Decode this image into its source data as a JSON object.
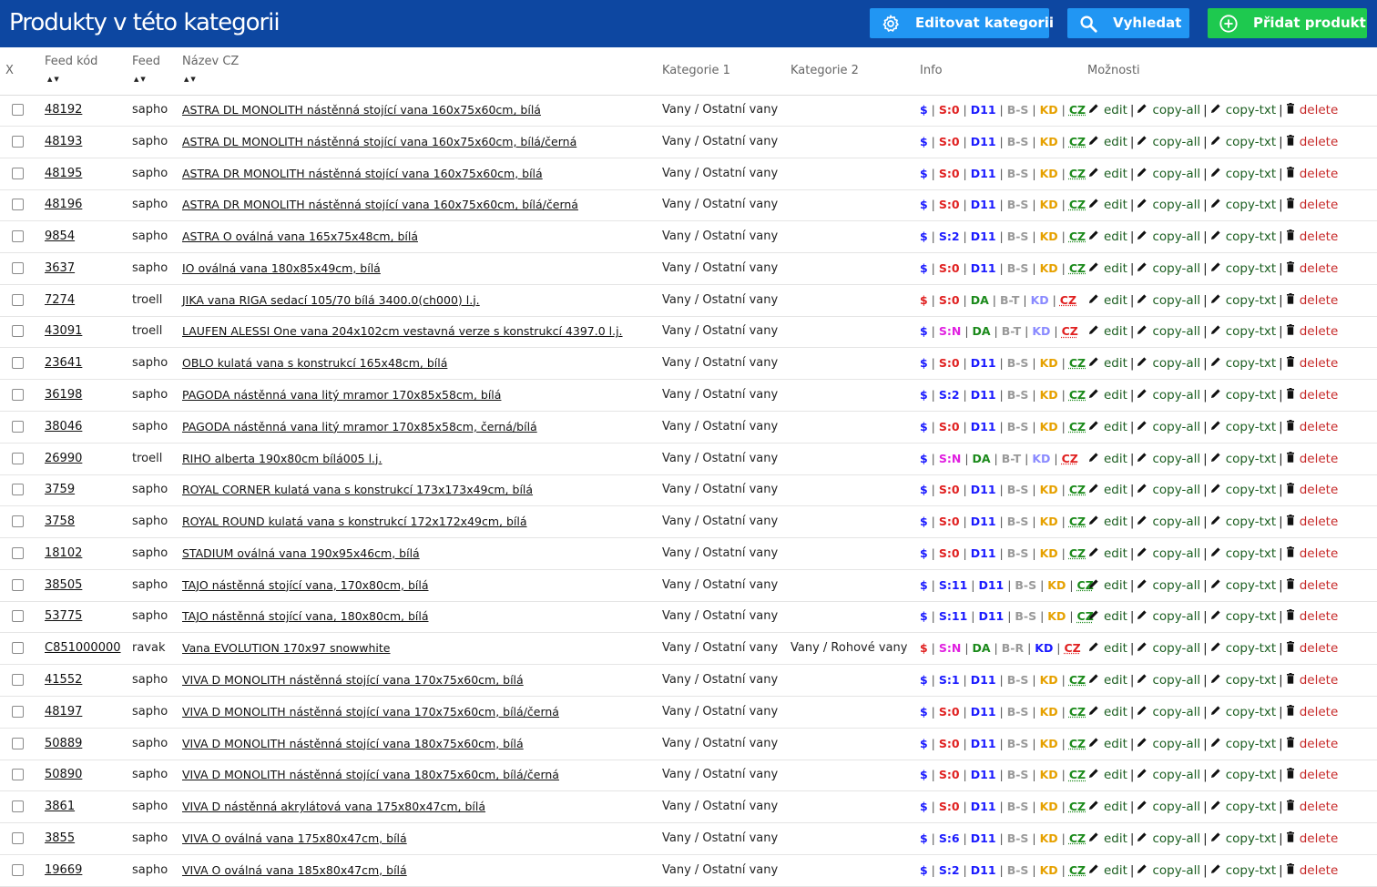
{
  "header": {
    "title": "Produkty v této kategorii",
    "buttons": {
      "edit_category": "Editovat kategorii",
      "search": "Vyhledat",
      "add_product": "Přidat produkt"
    },
    "colors": {
      "bar": "#0d47a1",
      "blue_button": "#2196f3",
      "green_button": "#1ec94f"
    }
  },
  "table": {
    "columns": {
      "x": "X",
      "feed_code": "Feed kód",
      "feed": "Feed",
      "name": "Název CZ",
      "category1": "Kategorie 1",
      "category2": "Kategorie 2",
      "info": "Info",
      "options": "Možnosti"
    },
    "sort_arrows": "▲▼",
    "option_labels": {
      "edit": "edit",
      "copy_all": "copy-all",
      "copy_txt": "copy-txt",
      "delete": "delete"
    },
    "rows": [
      {
        "code": "48192",
        "feed": "sapho",
        "name": "ASTRA DL MONOLITH nástěnná stojící vana 160x75x60cm, bílá",
        "cat1": "Vany / Ostatní vany",
        "cat2": "",
        "info": [
          [
            "$",
            "#1a1aff"
          ],
          [
            "S:0",
            "#e02020"
          ],
          [
            "D11",
            "#1a1aff"
          ],
          [
            "B-S",
            "#999999"
          ],
          [
            "KD",
            "#e6a100"
          ],
          [
            "CZ",
            "#1b8a1b"
          ]
        ]
      },
      {
        "code": "48193",
        "feed": "sapho",
        "name": "ASTRA DL MONOLITH nástěnná stojící vana 160x75x60cm, bílá/černá",
        "cat1": "Vany / Ostatní vany",
        "cat2": "",
        "info": [
          [
            "$",
            "#1a1aff"
          ],
          [
            "S:0",
            "#e02020"
          ],
          [
            "D11",
            "#1a1aff"
          ],
          [
            "B-S",
            "#999999"
          ],
          [
            "KD",
            "#e6a100"
          ],
          [
            "CZ",
            "#1b8a1b"
          ]
        ]
      },
      {
        "code": "48195",
        "feed": "sapho",
        "name": "ASTRA DR MONOLITH nástěnná stojící vana 160x75x60cm, bílá",
        "cat1": "Vany / Ostatní vany",
        "cat2": "",
        "info": [
          [
            "$",
            "#1a1aff"
          ],
          [
            "S:0",
            "#e02020"
          ],
          [
            "D11",
            "#1a1aff"
          ],
          [
            "B-S",
            "#999999"
          ],
          [
            "KD",
            "#e6a100"
          ],
          [
            "CZ",
            "#1b8a1b"
          ]
        ]
      },
      {
        "code": "48196",
        "feed": "sapho",
        "name": "ASTRA DR MONOLITH nástěnná stojící vana 160x75x60cm, bílá/černá",
        "cat1": "Vany / Ostatní vany",
        "cat2": "",
        "info": [
          [
            "$",
            "#1a1aff"
          ],
          [
            "S:0",
            "#e02020"
          ],
          [
            "D11",
            "#1a1aff"
          ],
          [
            "B-S",
            "#999999"
          ],
          [
            "KD",
            "#e6a100"
          ],
          [
            "CZ",
            "#1b8a1b"
          ]
        ]
      },
      {
        "code": "9854",
        "feed": "sapho",
        "name": "ASTRA O oválná vana 165x75x48cm, bílá",
        "cat1": "Vany / Ostatní vany",
        "cat2": "",
        "info": [
          [
            "$",
            "#1a1aff"
          ],
          [
            "S:2",
            "#1a1aff"
          ],
          [
            "D11",
            "#1a1aff"
          ],
          [
            "B-S",
            "#999999"
          ],
          [
            "KD",
            "#e6a100"
          ],
          [
            "CZ",
            "#1b8a1b"
          ]
        ]
      },
      {
        "code": "3637",
        "feed": "sapho",
        "name": "IO oválná vana 180x85x49cm, bílá",
        "cat1": "Vany / Ostatní vany",
        "cat2": "",
        "info": [
          [
            "$",
            "#1a1aff"
          ],
          [
            "S:0",
            "#e02020"
          ],
          [
            "D11",
            "#1a1aff"
          ],
          [
            "B-S",
            "#999999"
          ],
          [
            "KD",
            "#e6a100"
          ],
          [
            "CZ",
            "#1b8a1b"
          ]
        ]
      },
      {
        "code": "7274",
        "feed": "troell",
        "name": "JIKA vana RIGA sedací 105/70 bílá 3400.0(ch000) l.j.",
        "cat1": "Vany / Ostatní vany",
        "cat2": "",
        "info": [
          [
            "$",
            "#e02020"
          ],
          [
            "S:0",
            "#e02020"
          ],
          [
            "DA",
            "#1b8a1b"
          ],
          [
            "B-T",
            "#999999"
          ],
          [
            "KD",
            "#8a8aff"
          ],
          [
            "CZ",
            "#e02020"
          ]
        ]
      },
      {
        "code": "43091",
        "feed": "troell",
        "name": "LAUFEN ALESSI One vana 204x102cm vestavná verze s konstrukcí 4397.0 l.j.",
        "cat1": "Vany / Ostatní vany",
        "cat2": "",
        "info": [
          [
            "$",
            "#1a1aff"
          ],
          [
            "S:N",
            "#e020e0"
          ],
          [
            "DA",
            "#1b8a1b"
          ],
          [
            "B-T",
            "#999999"
          ],
          [
            "KD",
            "#8a8aff"
          ],
          [
            "CZ",
            "#e02020"
          ]
        ]
      },
      {
        "code": "23641",
        "feed": "sapho",
        "name": "OBLO kulatá vana s konstrukcí 165x48cm, bílá",
        "cat1": "Vany / Ostatní vany",
        "cat2": "",
        "info": [
          [
            "$",
            "#1a1aff"
          ],
          [
            "S:0",
            "#e02020"
          ],
          [
            "D11",
            "#1a1aff"
          ],
          [
            "B-S",
            "#999999"
          ],
          [
            "KD",
            "#e6a100"
          ],
          [
            "CZ",
            "#1b8a1b"
          ]
        ]
      },
      {
        "code": "36198",
        "feed": "sapho",
        "name": "PAGODA nástěnná vana litý mramor 170x85x58cm, bílá",
        "cat1": "Vany / Ostatní vany",
        "cat2": "",
        "info": [
          [
            "$",
            "#1a1aff"
          ],
          [
            "S:2",
            "#1a1aff"
          ],
          [
            "D11",
            "#1a1aff"
          ],
          [
            "B-S",
            "#999999"
          ],
          [
            "KD",
            "#e6a100"
          ],
          [
            "CZ",
            "#1b8a1b"
          ]
        ]
      },
      {
        "code": "38046",
        "feed": "sapho",
        "name": "PAGODA nástěnná vana litý mramor 170x85x58cm, černá/bílá",
        "cat1": "Vany / Ostatní vany",
        "cat2": "",
        "info": [
          [
            "$",
            "#1a1aff"
          ],
          [
            "S:0",
            "#e02020"
          ],
          [
            "D11",
            "#1a1aff"
          ],
          [
            "B-S",
            "#999999"
          ],
          [
            "KD",
            "#e6a100"
          ],
          [
            "CZ",
            "#1b8a1b"
          ]
        ]
      },
      {
        "code": "26990",
        "feed": "troell",
        "name": "RIHO alberta 190x80cm bílá005 l.j.",
        "cat1": "Vany / Ostatní vany",
        "cat2": "",
        "info": [
          [
            "$",
            "#1a1aff"
          ],
          [
            "S:N",
            "#e020e0"
          ],
          [
            "DA",
            "#1b8a1b"
          ],
          [
            "B-T",
            "#999999"
          ],
          [
            "KD",
            "#8a8aff"
          ],
          [
            "CZ",
            "#e02020"
          ]
        ]
      },
      {
        "code": "3759",
        "feed": "sapho",
        "name": "ROYAL CORNER kulatá vana s konstrukcí 173x173x49cm, bílá",
        "cat1": "Vany / Ostatní vany",
        "cat2": "",
        "info": [
          [
            "$",
            "#1a1aff"
          ],
          [
            "S:0",
            "#e02020"
          ],
          [
            "D11",
            "#1a1aff"
          ],
          [
            "B-S",
            "#999999"
          ],
          [
            "KD",
            "#e6a100"
          ],
          [
            "CZ",
            "#1b8a1b"
          ]
        ]
      },
      {
        "code": "3758",
        "feed": "sapho",
        "name": "ROYAL ROUND kulatá vana s konstrukcí 172x172x49cm, bílá",
        "cat1": "Vany / Ostatní vany",
        "cat2": "",
        "info": [
          [
            "$",
            "#1a1aff"
          ],
          [
            "S:0",
            "#e02020"
          ],
          [
            "D11",
            "#1a1aff"
          ],
          [
            "B-S",
            "#999999"
          ],
          [
            "KD",
            "#e6a100"
          ],
          [
            "CZ",
            "#1b8a1b"
          ]
        ]
      },
      {
        "code": "18102",
        "feed": "sapho",
        "name": "STADIUM oválná vana 190x95x46cm, bílá",
        "cat1": "Vany / Ostatní vany",
        "cat2": "",
        "info": [
          [
            "$",
            "#1a1aff"
          ],
          [
            "S:0",
            "#e02020"
          ],
          [
            "D11",
            "#1a1aff"
          ],
          [
            "B-S",
            "#999999"
          ],
          [
            "KD",
            "#e6a100"
          ],
          [
            "CZ",
            "#1b8a1b"
          ]
        ]
      },
      {
        "code": "38505",
        "feed": "sapho",
        "name": "TAJO nástěnná stojící vana, 170x80cm, bílá",
        "cat1": "Vany / Ostatní vany",
        "cat2": "",
        "info": [
          [
            "$",
            "#1a1aff"
          ],
          [
            "S:11",
            "#1a1aff"
          ],
          [
            "D11",
            "#1a1aff"
          ],
          [
            "B-S",
            "#999999"
          ],
          [
            "KD",
            "#e6a100"
          ],
          [
            "CZ",
            "#1b8a1b"
          ]
        ]
      },
      {
        "code": "53775",
        "feed": "sapho",
        "name": "TAJO nástěnná stojící vana, 180x80cm, bílá",
        "cat1": "Vany / Ostatní vany",
        "cat2": "",
        "info": [
          [
            "$",
            "#1a1aff"
          ],
          [
            "S:11",
            "#1a1aff"
          ],
          [
            "D11",
            "#1a1aff"
          ],
          [
            "B-S",
            "#999999"
          ],
          [
            "KD",
            "#e6a100"
          ],
          [
            "CZ",
            "#1b8a1b"
          ]
        ]
      },
      {
        "code": "C851000000",
        "feed": "ravak",
        "name": "Vana EVOLUTION 170x97 snowwhite",
        "cat1": "Vany / Ostatní vany",
        "cat2": "Vany / Rohové vany",
        "info": [
          [
            "$",
            "#e02020"
          ],
          [
            "S:N",
            "#e020e0"
          ],
          [
            "DA",
            "#1b8a1b"
          ],
          [
            "B-R",
            "#999999"
          ],
          [
            "KD",
            "#1a1aff"
          ],
          [
            "CZ",
            "#e02020"
          ]
        ]
      },
      {
        "code": "41552",
        "feed": "sapho",
        "name": "VIVA D MONOLITH nástěnná stojící vana 170x75x60cm, bílá",
        "cat1": "Vany / Ostatní vany",
        "cat2": "",
        "info": [
          [
            "$",
            "#1a1aff"
          ],
          [
            "S:1",
            "#1a1aff"
          ],
          [
            "D11",
            "#1a1aff"
          ],
          [
            "B-S",
            "#999999"
          ],
          [
            "KD",
            "#e6a100"
          ],
          [
            "CZ",
            "#1b8a1b"
          ]
        ]
      },
      {
        "code": "48197",
        "feed": "sapho",
        "name": "VIVA D MONOLITH nástěnná stojící vana 170x75x60cm, bílá/černá",
        "cat1": "Vany / Ostatní vany",
        "cat2": "",
        "info": [
          [
            "$",
            "#1a1aff"
          ],
          [
            "S:0",
            "#e02020"
          ],
          [
            "D11",
            "#1a1aff"
          ],
          [
            "B-S",
            "#999999"
          ],
          [
            "KD",
            "#e6a100"
          ],
          [
            "CZ",
            "#1b8a1b"
          ]
        ]
      },
      {
        "code": "50889",
        "feed": "sapho",
        "name": "VIVA D MONOLITH nástěnná stojící vana 180x75x60cm, bílá",
        "cat1": "Vany / Ostatní vany",
        "cat2": "",
        "info": [
          [
            "$",
            "#1a1aff"
          ],
          [
            "S:0",
            "#e02020"
          ],
          [
            "D11",
            "#1a1aff"
          ],
          [
            "B-S",
            "#999999"
          ],
          [
            "KD",
            "#e6a100"
          ],
          [
            "CZ",
            "#1b8a1b"
          ]
        ]
      },
      {
        "code": "50890",
        "feed": "sapho",
        "name": "VIVA D MONOLITH nástěnná stojící vana 180x75x60cm, bílá/černá",
        "cat1": "Vany / Ostatní vany",
        "cat2": "",
        "info": [
          [
            "$",
            "#1a1aff"
          ],
          [
            "S:0",
            "#e02020"
          ],
          [
            "D11",
            "#1a1aff"
          ],
          [
            "B-S",
            "#999999"
          ],
          [
            "KD",
            "#e6a100"
          ],
          [
            "CZ",
            "#1b8a1b"
          ]
        ]
      },
      {
        "code": "3861",
        "feed": "sapho",
        "name": "VIVA D nástěnná akrylátová vana 175x80x47cm, bílá",
        "cat1": "Vany / Ostatní vany",
        "cat2": "",
        "info": [
          [
            "$",
            "#1a1aff"
          ],
          [
            "S:0",
            "#e02020"
          ],
          [
            "D11",
            "#1a1aff"
          ],
          [
            "B-S",
            "#999999"
          ],
          [
            "KD",
            "#e6a100"
          ],
          [
            "CZ",
            "#1b8a1b"
          ]
        ]
      },
      {
        "code": "3855",
        "feed": "sapho",
        "name": "VIVA O oválná vana 175x80x47cm, bílá",
        "cat1": "Vany / Ostatní vany",
        "cat2": "",
        "info": [
          [
            "$",
            "#1a1aff"
          ],
          [
            "S:6",
            "#1a1aff"
          ],
          [
            "D11",
            "#1a1aff"
          ],
          [
            "B-S",
            "#999999"
          ],
          [
            "KD",
            "#e6a100"
          ],
          [
            "CZ",
            "#1b8a1b"
          ]
        ]
      },
      {
        "code": "19669",
        "feed": "sapho",
        "name": "VIVA O oválná vana 185x80x47cm, bílá",
        "cat1": "Vany / Ostatní vany",
        "cat2": "",
        "info": [
          [
            "$",
            "#1a1aff"
          ],
          [
            "S:2",
            "#1a1aff"
          ],
          [
            "D11",
            "#1a1aff"
          ],
          [
            "B-S",
            "#999999"
          ],
          [
            "KD",
            "#e6a100"
          ],
          [
            "CZ",
            "#1b8a1b"
          ]
        ]
      }
    ]
  }
}
